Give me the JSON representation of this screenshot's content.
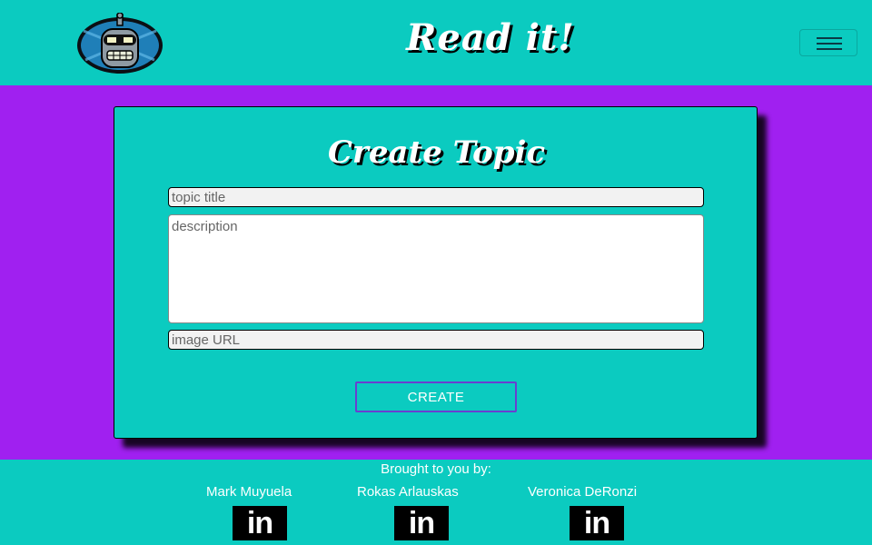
{
  "header": {
    "brand": "Read it!",
    "logo_icon": "bender-robot-logo",
    "menu_icon": "hamburger-menu-icon"
  },
  "form": {
    "title": "Create Topic",
    "topic_title_placeholder": "topic title",
    "description_placeholder": "description",
    "image_url_placeholder": "image URL",
    "submit_label": "CREATE"
  },
  "footer": {
    "brought_by": "Brought to you by:",
    "authors": [
      {
        "name": "Mark Muyuela",
        "link_label": "in",
        "icon": "linkedin-icon"
      },
      {
        "name": "Rokas Arlauskas",
        "link_label": "in",
        "icon": "linkedin-icon"
      },
      {
        "name": "Veronica DeRonzi",
        "link_label": "in",
        "icon": "linkedin-icon"
      }
    ]
  },
  "colors": {
    "teal": "#0bcbc0",
    "purple": "#a020f0",
    "button_border": "#6a3fd0"
  }
}
